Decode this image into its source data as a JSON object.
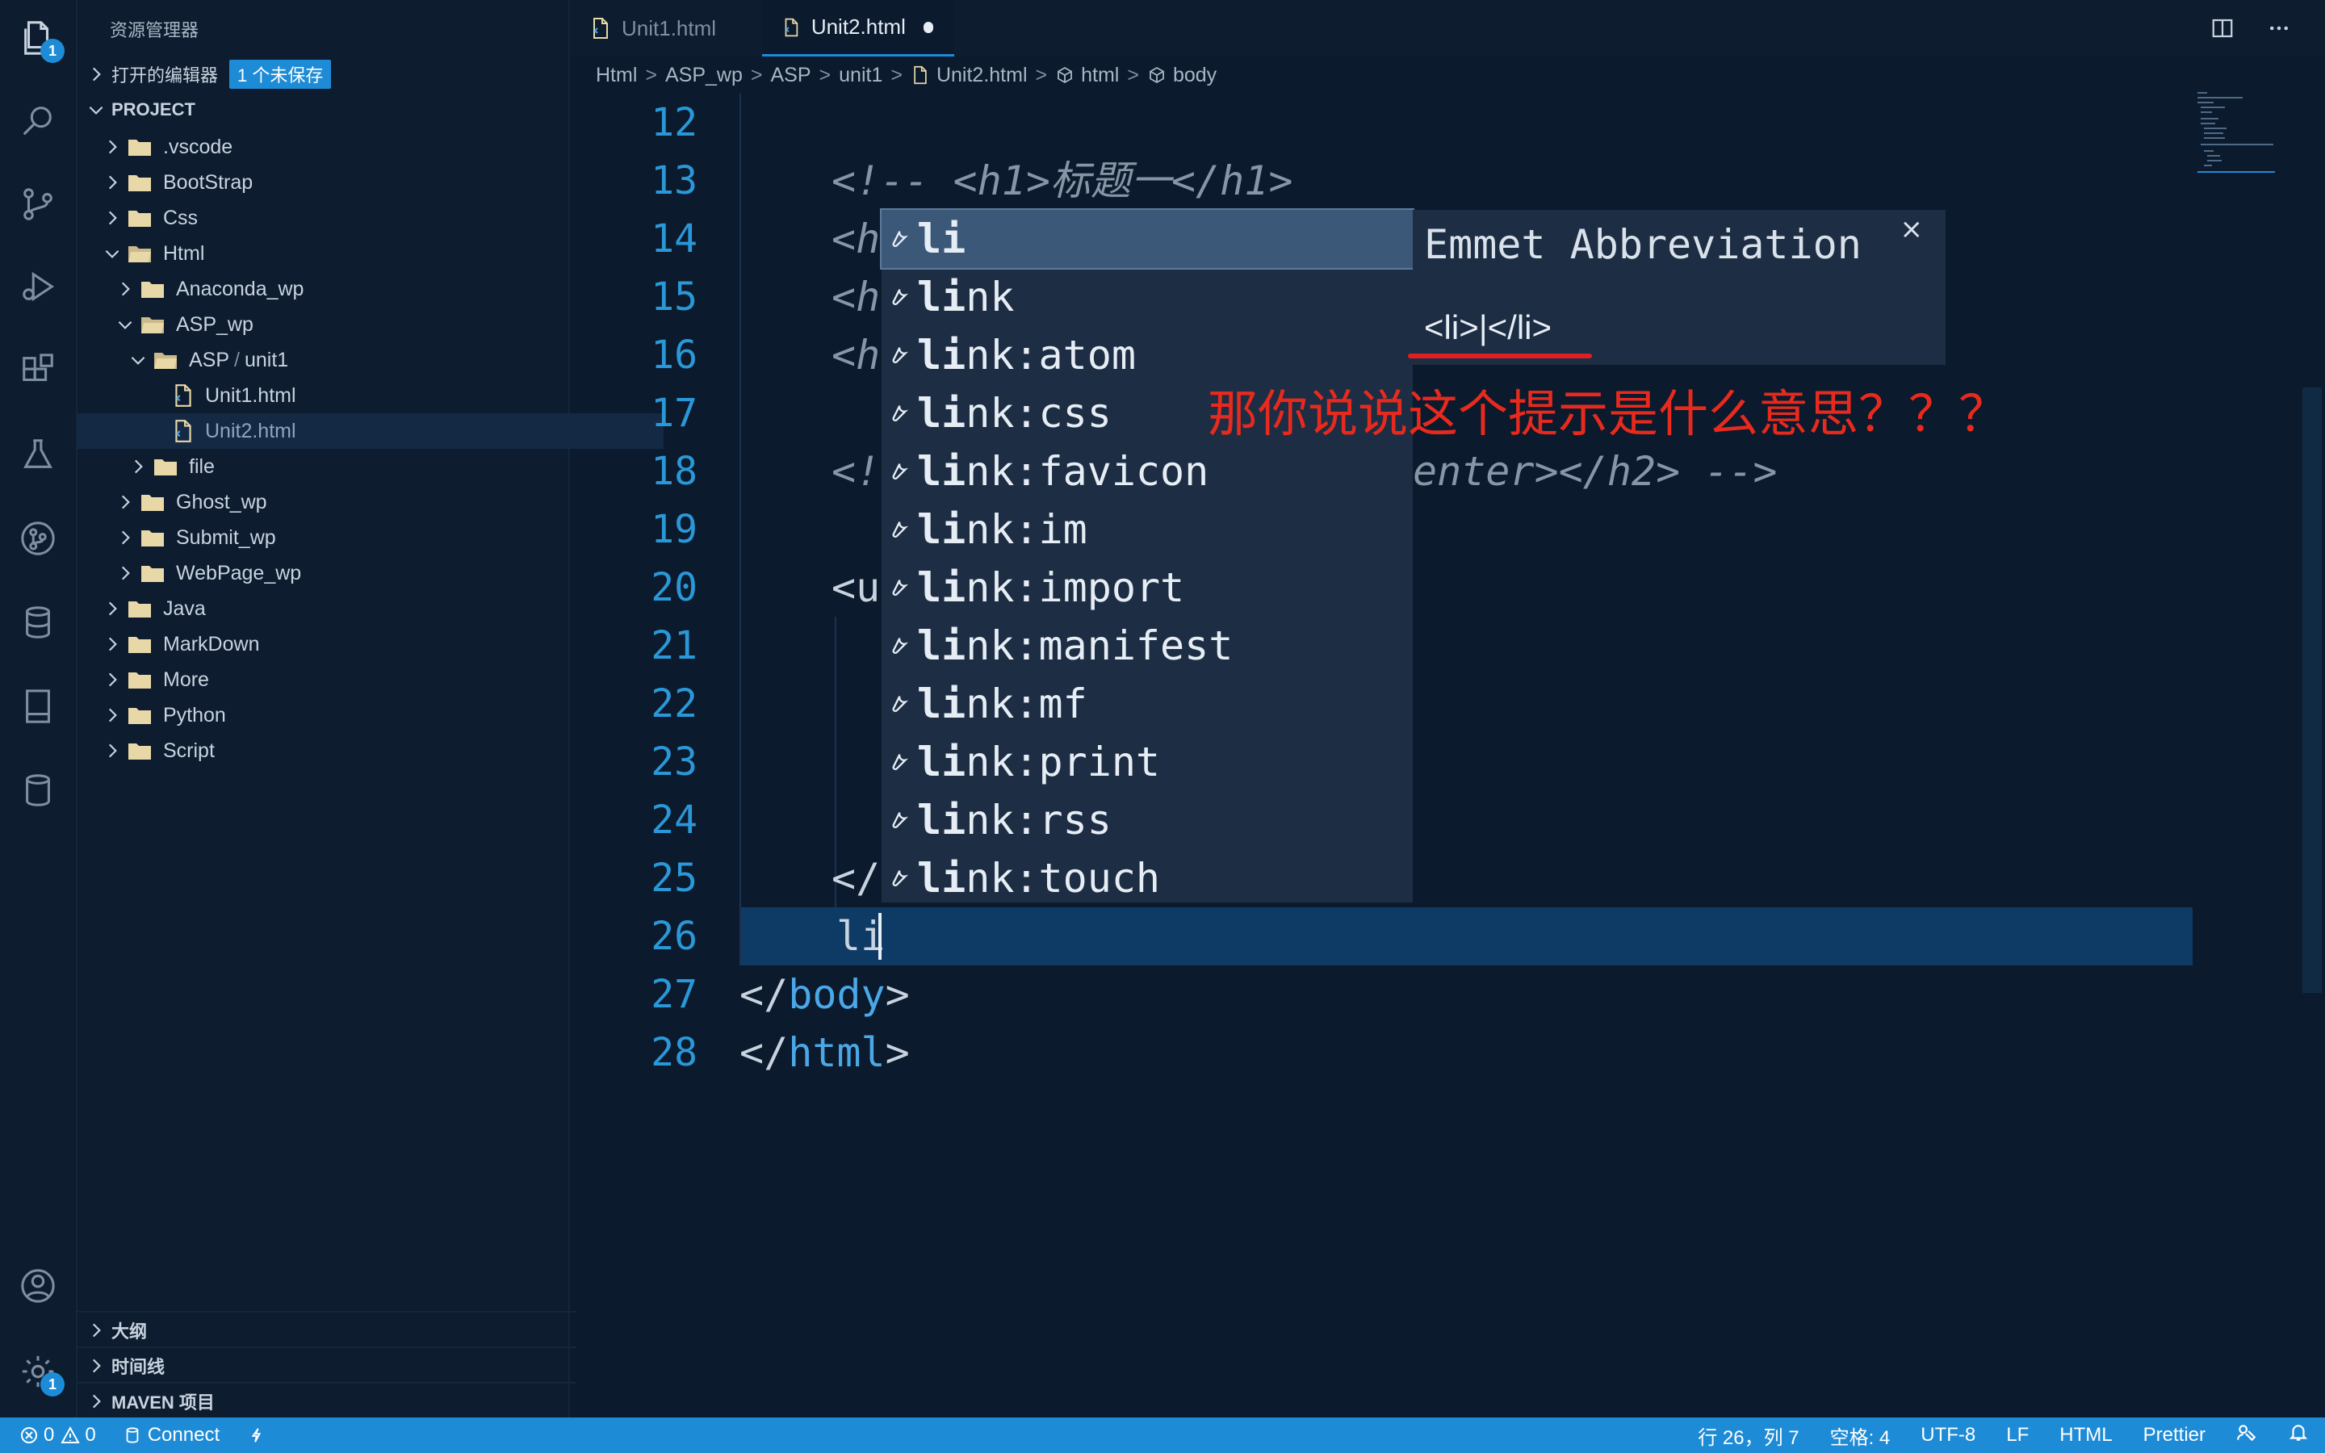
{
  "sidebar": {
    "title": "资源管理器",
    "open_editors_label": "打开的编辑器",
    "unsaved_badge": "1 个未保存",
    "project_label": "PROJECT",
    "tree": [
      {
        "label": ".vscode"
      },
      {
        "label": "BootStrap"
      },
      {
        "label": "Css"
      },
      {
        "label": "Html"
      },
      {
        "label": "Anaconda_wp"
      },
      {
        "label": "ASP_wp"
      },
      {
        "label": "ASP"
      },
      {
        "label": "unit1"
      },
      {
        "label": "Unit1.html"
      },
      {
        "label": "Unit2.html"
      },
      {
        "label": "file"
      },
      {
        "label": "Ghost_wp"
      },
      {
        "label": "Submit_wp"
      },
      {
        "label": "WebPage_wp"
      },
      {
        "label": "Java"
      },
      {
        "label": "MarkDown"
      },
      {
        "label": "More"
      },
      {
        "label": "Python"
      },
      {
        "label": "Script"
      }
    ],
    "sections": [
      "大纲",
      "时间线",
      "MAVEN 项目"
    ]
  },
  "activity": {
    "explorer_badge": "1",
    "settings_badge": "1"
  },
  "tabs": [
    {
      "label": "Unit1.html"
    },
    {
      "label": "Unit2.html"
    }
  ],
  "breadcrumb": [
    "Html",
    "ASP_wp",
    "ASP",
    "unit1",
    "Unit2.html",
    "html",
    "body"
  ],
  "editor": {
    "line_numbers": [
      "12",
      "13",
      "14",
      "15",
      "16",
      "17",
      "18",
      "19",
      "20",
      "21",
      "22",
      "23",
      "24",
      "25",
      "26",
      "27",
      "28"
    ],
    "lines": {
      "l13": "<!-- <h1>标题一</h1>",
      "l14": "<h",
      "l15": "<h",
      "l16": "<h",
      "l18a": "<!",
      "l18b": "enter></h2> -->",
      "l20": "<u",
      "l25": "</",
      "l26": "li",
      "l27a": "</",
      "l27b": "body",
      "l27c": ">",
      "l28a": "</",
      "l28b": "html",
      "l28c": ">"
    }
  },
  "suggest": {
    "items": [
      {
        "match": "li",
        "rest": ""
      },
      {
        "match": "li",
        "rest": "nk"
      },
      {
        "match": "li",
        "rest": "nk:atom"
      },
      {
        "match": "li",
        "rest": "nk:css"
      },
      {
        "match": "li",
        "rest": "nk:favicon"
      },
      {
        "match": "li",
        "rest": "nk:im"
      },
      {
        "match": "li",
        "rest": "nk:import"
      },
      {
        "match": "li",
        "rest": "nk:manifest"
      },
      {
        "match": "li",
        "rest": "nk:mf"
      },
      {
        "match": "li",
        "rest": "nk:print"
      },
      {
        "match": "li",
        "rest": "nk:rss"
      },
      {
        "match": "li",
        "rest": "nk:touch"
      }
    ],
    "details_title": "Emmet Abbreviation",
    "details_body": "<li>|</li>",
    "close_symbol": "×"
  },
  "annotation": "那你说说这个提示是什么意思？？？",
  "status": {
    "errors": "0",
    "warnings": "0",
    "connect": "Connect",
    "position": "行 26，列 7",
    "spaces": "空格: 4",
    "encoding": "UTF-8",
    "eol": "LF",
    "language": "HTML",
    "formatter": "Prettier"
  },
  "colors": {
    "accent": "#1e8bd6",
    "background": "#0b1a2c",
    "annotation": "#e82a1e"
  }
}
